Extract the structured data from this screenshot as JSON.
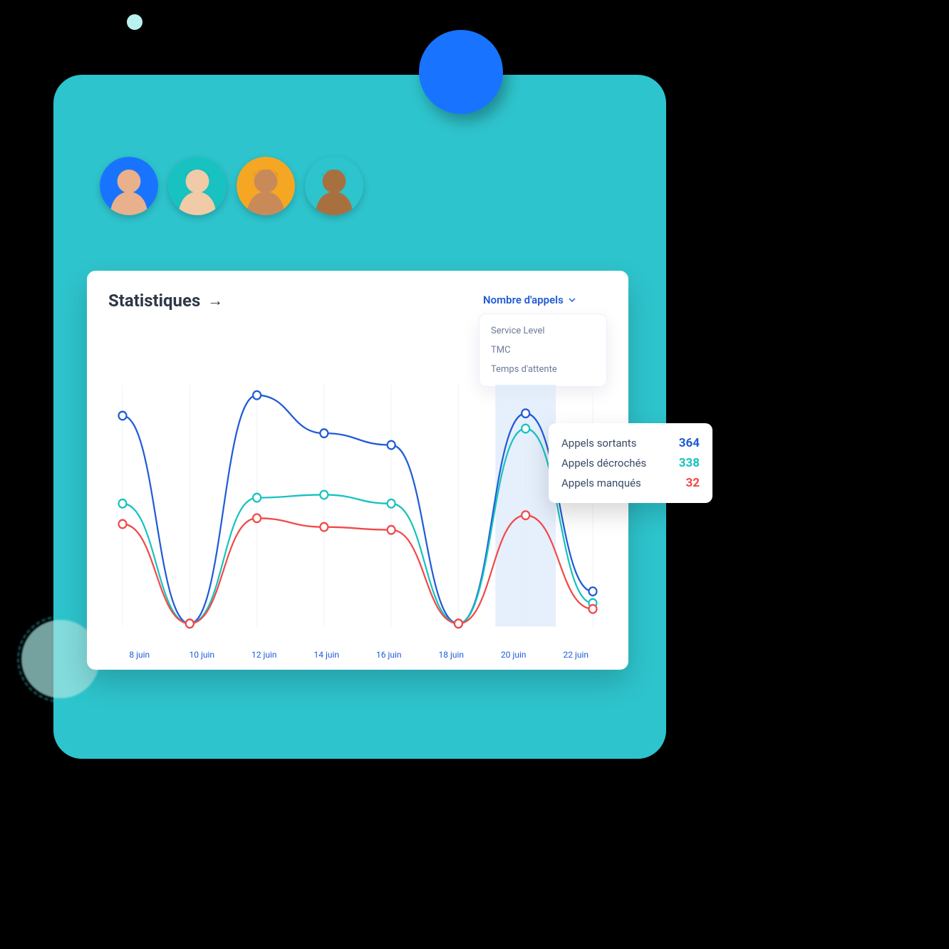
{
  "title": "Statistiques",
  "dropdown": {
    "selected": "Nombre d'appels",
    "items": [
      "Service Level",
      "TMC",
      "Temps d'attente"
    ]
  },
  "tooltip": {
    "rows": [
      {
        "label": "Appels sortants",
        "value": 364,
        "color": "c-blue"
      },
      {
        "label": "Appels décrochés",
        "value": 338,
        "color": "c-teal"
      },
      {
        "label": "Appels manqués",
        "value": 32,
        "color": "c-red"
      }
    ],
    "highlight_index": 6
  },
  "avatars": [
    {
      "bg": "#1874ff",
      "skin": "#e8b08b",
      "hair": "#7a4a25"
    },
    {
      "bg": "#17c2c0",
      "skin": "#f1cba7",
      "hair": "#2b2b2b"
    },
    {
      "bg": "#f5a623",
      "skin": "#c98a5a",
      "hair": "#1e1e1e"
    },
    {
      "bg": "#2ec4cd",
      "skin": "#a8703e",
      "hair": "#2b1a12"
    }
  ],
  "chart_data": {
    "type": "line",
    "title": "Statistiques",
    "xlabel": "",
    "ylabel": "",
    "ylim": [
      0,
      400
    ],
    "categories": [
      "8 juin",
      "10 juin",
      "12 juin",
      "14 juin",
      "16 juin",
      "18 juin",
      "20 juin",
      "22 juin"
    ],
    "series": [
      {
        "name": "Appels sortants",
        "color": "#1f5bd6",
        "values": [
          360,
          5,
          395,
          330,
          310,
          5,
          364,
          60
        ]
      },
      {
        "name": "Appels décrochés",
        "color": "#17c2c0",
        "values": [
          210,
          5,
          220,
          225,
          210,
          5,
          338,
          40
        ]
      },
      {
        "name": "Appels manqués",
        "color": "#f24949",
        "values": [
          175,
          5,
          185,
          170,
          165,
          5,
          190,
          30
        ]
      }
    ]
  }
}
